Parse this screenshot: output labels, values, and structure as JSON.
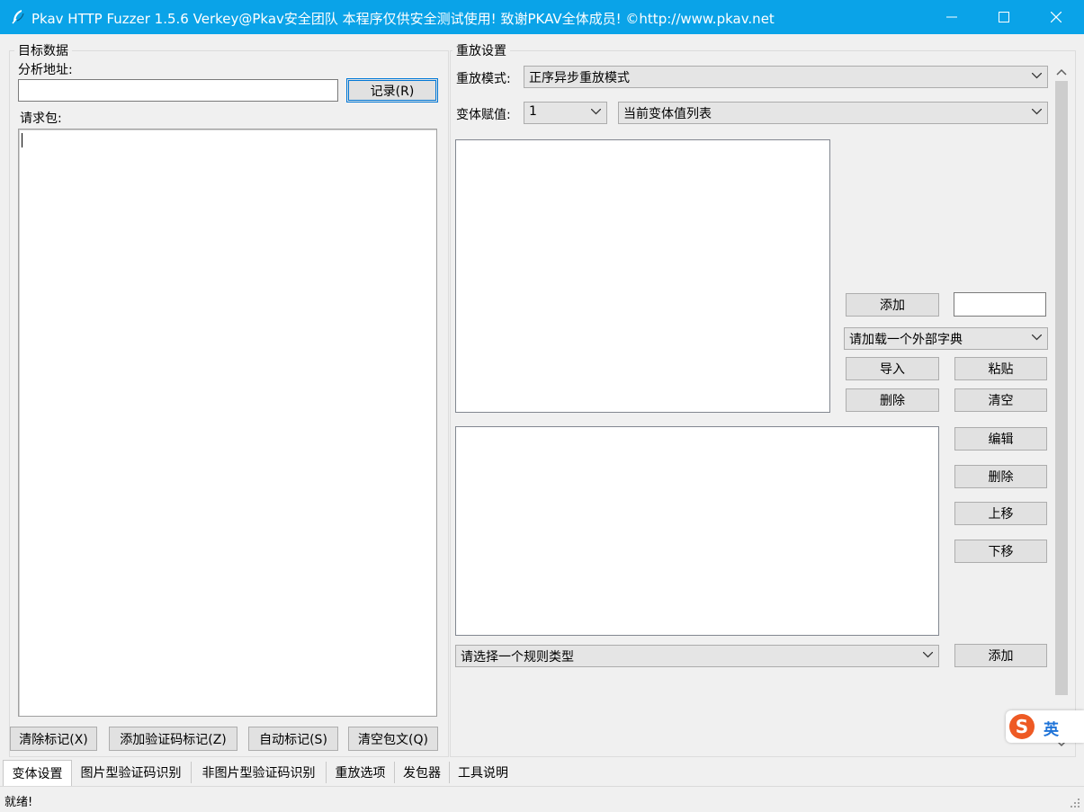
{
  "window": {
    "title": "Pkav HTTP Fuzzer 1.5.6  Verkey@Pkav安全团队  本程序仅供安全测试使用!  致谢PKAV全体成员! ©http://www.pkav.net",
    "icon": "feather-logo-icon",
    "accent_color": "#0aa3e8"
  },
  "target": {
    "group_title": "目标数据",
    "address_label": "分析地址:",
    "address_value": "",
    "record_button": "记录(R)",
    "request_label": "请求包:",
    "request_value": "",
    "buttons": {
      "clear_marks": "清除标记(X)",
      "add_captcha_mark": "添加验证码标记(Z)",
      "auto_mark": "自动标记(S)",
      "clear_body": "清空包文(Q)"
    }
  },
  "replay": {
    "group_title": "重放设置",
    "mode_label": "重放模式:",
    "mode_value": "正序异步重放模式",
    "var_label": "变体赋值:",
    "var_index": "1",
    "var_list": "当前变体值列表",
    "add_button": "添加",
    "add_input_value": "",
    "dict_select": "请加载一个外部字典",
    "import_button": "导入",
    "paste_button": "粘贴",
    "delete_button": "删除",
    "clear_button": "清空",
    "edit_button": "编辑",
    "delete_rule_button": "删除",
    "move_up_button": "上移",
    "move_down_button": "下移",
    "rule_type_select": "请选择一个规则类型",
    "add_rule_button": "添加"
  },
  "tabs": [
    {
      "label": "变体设置",
      "active": true
    },
    {
      "label": "图片型验证码识别",
      "active": false
    },
    {
      "label": "非图片型验证码识别",
      "active": false
    },
    {
      "label": "重放选项",
      "active": false
    },
    {
      "label": "发包器",
      "active": false
    },
    {
      "label": "工具说明",
      "active": false
    }
  ],
  "status": {
    "text": "就绪!"
  },
  "ime": {
    "logo": "S",
    "mode": "英"
  }
}
